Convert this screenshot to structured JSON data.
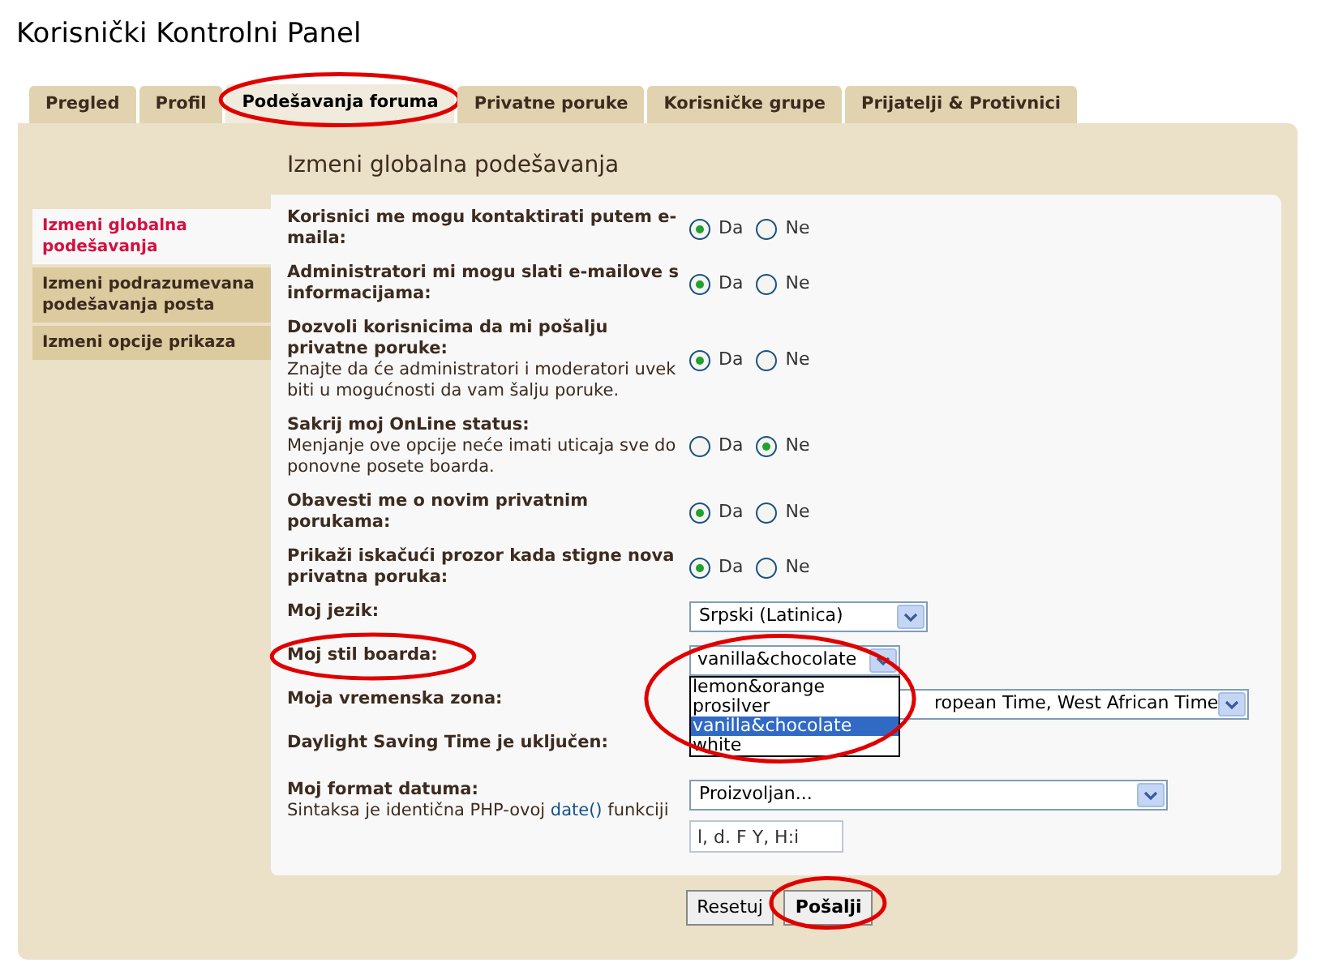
{
  "title": "Korisnički Kontrolni Panel",
  "tabs": [
    {
      "label": "Pregled",
      "selected": false,
      "circled": false
    },
    {
      "label": "Profil",
      "selected": false,
      "circled": false
    },
    {
      "label": "Podešavanja foruma",
      "selected": true,
      "circled": true
    },
    {
      "label": "Privatne poruke",
      "selected": false,
      "circled": false
    },
    {
      "label": "Korisničke grupe",
      "selected": false,
      "circled": false
    },
    {
      "label": "Prijatelji & Protivnici",
      "selected": false,
      "circled": false
    }
  ],
  "section_title": "Izmeni globalna podešavanja",
  "sidebar": {
    "items": [
      {
        "label": "Izmeni globalna podešavanja",
        "selected": true
      },
      {
        "label": "Izmeni podrazumevana podešavanja posta",
        "selected": false
      },
      {
        "label": "Izmeni opcije prikaza",
        "selected": false
      }
    ]
  },
  "settings": [
    {
      "kind": "radio",
      "label": "Korisnici me mogu kontaktirati putem e-maila:",
      "options": [
        {
          "label": "Da",
          "selected": true
        },
        {
          "label": "Ne",
          "selected": false
        }
      ]
    },
    {
      "kind": "radio",
      "label": "Administratori mi mogu slati e-mailove s informacijama:",
      "options": [
        {
          "label": "Da",
          "selected": true
        },
        {
          "label": "Ne",
          "selected": false
        }
      ]
    },
    {
      "kind": "radio",
      "label": "Dozvoli korisnicima da mi pošalju privatne poruke:",
      "note": "Znajte da će administratori i moderatori uvek biti u mogućnosti da vam šalju poruke.",
      "options": [
        {
          "label": "Da",
          "selected": true
        },
        {
          "label": "Ne",
          "selected": false
        }
      ]
    },
    {
      "kind": "radio",
      "label": "Sakrij moj OnLine status:",
      "note": "Menjanje ove opcije neće imati uticaja sve do ponovne posete boarda.",
      "options": [
        {
          "label": "Da",
          "selected": false
        },
        {
          "label": "Ne",
          "selected": true
        }
      ]
    },
    {
      "kind": "radio",
      "label": "Obavesti me o novim privatnim porukama:",
      "options": [
        {
          "label": "Da",
          "selected": true
        },
        {
          "label": "Ne",
          "selected": false
        }
      ]
    },
    {
      "kind": "radio",
      "label": "Prikaži iskačući prozor kada stigne nova privatna poruka:",
      "options": [
        {
          "label": "Da",
          "selected": true
        },
        {
          "label": "Ne",
          "selected": false
        }
      ]
    },
    {
      "kind": "select",
      "label": "Moj jezik:",
      "value": "Srpski (Latinica)"
    },
    {
      "kind": "style",
      "label": "Moj stil boarda:",
      "value": "vanilla&chocolate",
      "circled": true,
      "open_options": [
        {
          "label": "lemon&orange",
          "selected": false
        },
        {
          "label": "prosilver",
          "selected": false
        },
        {
          "label": "vanilla&chocolate",
          "selected": true
        },
        {
          "label": "white",
          "selected": false
        }
      ]
    },
    {
      "kind": "covered",
      "label": "Moja vremenska zona:",
      "value": "ropean Time, West African Time"
    },
    {
      "kind": "hidden",
      "label": "Daylight Saving Time je uključen:"
    },
    {
      "kind": "dateformat",
      "label": "Moj format datuma:",
      "note": "Sintaksa je identična PHP-ovoj",
      "link": "date()",
      "note_after": "funkciji",
      "value": "Proizvoljan...",
      "input": "l, d. F Y, H:i"
    }
  ],
  "buttons": [
    {
      "label": "Resetuj",
      "kind": "reset",
      "circled": false
    },
    {
      "label": "Pošalji",
      "kind": "submit",
      "circled": true
    }
  ]
}
